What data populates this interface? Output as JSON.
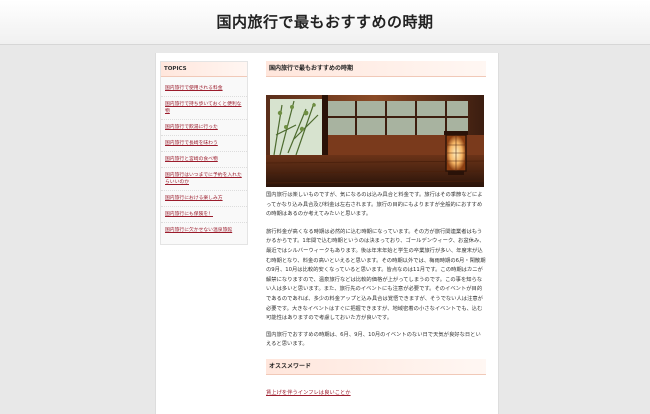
{
  "header": {
    "title": "国内旅行で最もおすすめの時期"
  },
  "sidebar": {
    "title": "TOPICS",
    "items": [
      {
        "label": "国内旅行で使用される料金"
      },
      {
        "label": "国内旅行で持ち歩いておくと便利な物"
      },
      {
        "label": "国内旅行で飲湯に行った"
      },
      {
        "label": "国内旅行で長崎を味わう"
      },
      {
        "label": "国内旅行と宮崎の食べ物"
      },
      {
        "label": "国内旅行はいつまでに予約を入れたらいいのか"
      },
      {
        "label": "国内旅行における楽しみ方"
      },
      {
        "label": "国内旅行にも保険を！"
      },
      {
        "label": "国内旅行に欠かせない温泉旅館"
      }
    ]
  },
  "main": {
    "section_title": "国内旅行で最もおすすめの時期",
    "paragraphs": [
      "国内旅行は楽しいものですが、気になるのは込み具合と料金です。旅行はその季節などによってかなり込み具合及び料金は左右されます。旅行の目的にもよりますが全般的におすすめの時期はあるのか考えてみたいと思います。",
      "旅行料金が高くなる時期は必然的に込む時期になっています。その方が旅行関連業者はもうかるからです。1年間で込む時期というのは決まっており、ゴールデンウィーク、お盆休み、最近ではシルバーウィークもあります。後は年末年始と学生の卒業旅行が多い、年度末が込む時期となり、料金の高いといえると思います。その時期以外では、梅雨時期の6月・閑散期の9月、10月は比較的安くなっていると思います。皆点なのは11月です。この時期はカニが解禁になりますので、温泉旅行などは比較的価格が上がってしまうのです。この事を知らない人は多いと思います。また、旅行先のイベントにも注意が必要です。そのイベントが目的であるのであれば、多少の料金アップと込み具合は覚悟できますが、そうでない人は注意が必要です。大きなイベントはすぐに把握できますが、地域密着の小さなイベントでも、込む可能性はありますので考慮しておいた方が良いです。",
      "国内旅行でおすすめの時期は、6月、9月、10月のイベントのない日で天気が良好な日といえると思います。"
    ],
    "keywords_title": "オススメワード",
    "keyword_link": "賃上げを伴うインフレは良いことか"
  }
}
